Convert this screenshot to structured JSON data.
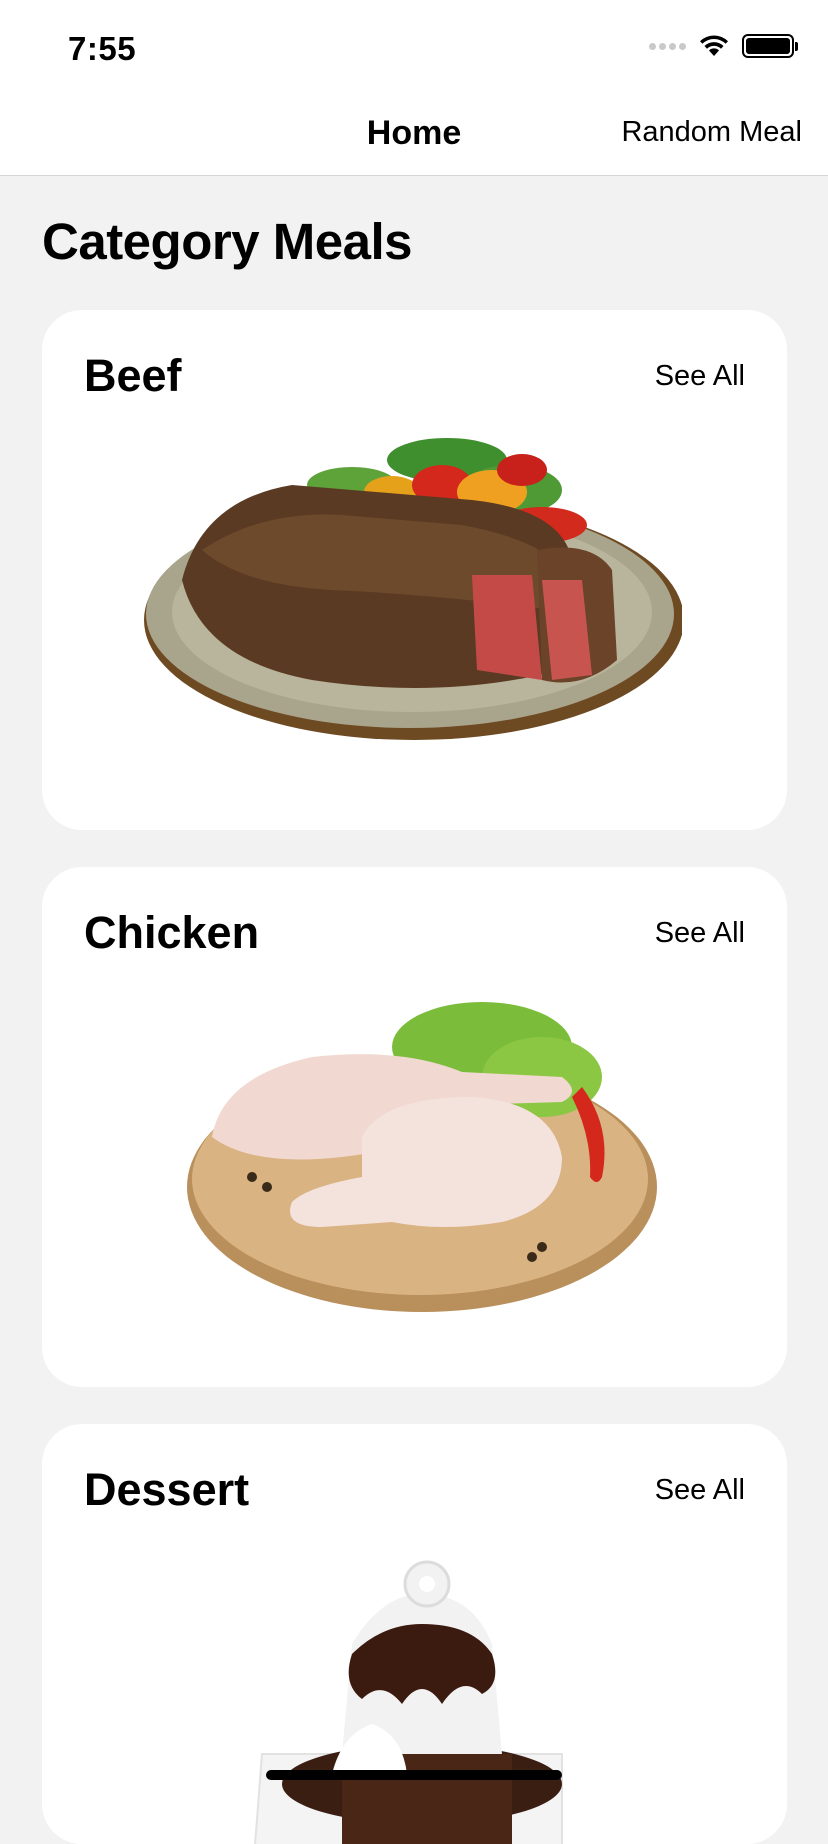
{
  "status_bar": {
    "time": "7:55"
  },
  "nav": {
    "title": "Home",
    "action": "Random Meal"
  },
  "section": {
    "title": "Category Meals"
  },
  "categories": [
    {
      "name": "Beef",
      "see_all": "See All",
      "image_icon": "beef-steak-plate"
    },
    {
      "name": "Chicken",
      "see_all": "See All",
      "image_icon": "raw-chicken-legs-board"
    },
    {
      "name": "Dessert",
      "see_all": "See All",
      "image_icon": "chocolate-sundae"
    }
  ]
}
